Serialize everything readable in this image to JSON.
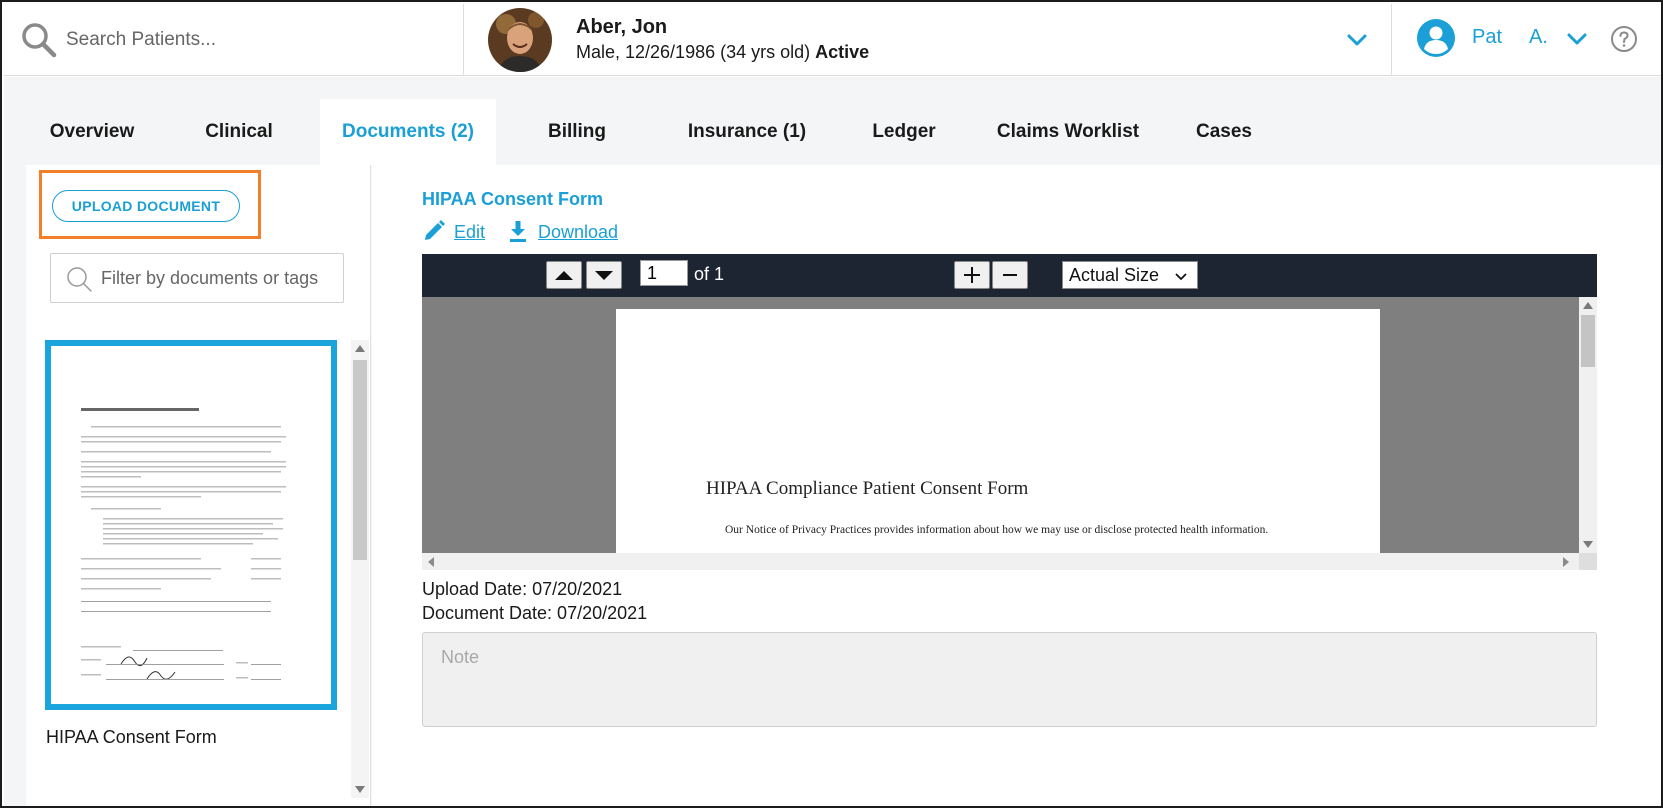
{
  "header": {
    "search_placeholder": "Search Patients...",
    "patient": {
      "name": "Aber, Jon",
      "demographics": "Male, 12/26/1986 (34 yrs old)",
      "status": "Active"
    },
    "user": {
      "first_name": "Pat",
      "last_initial": "A."
    }
  },
  "tabs": [
    {
      "label": "Overview",
      "active": false
    },
    {
      "label": "Clinical",
      "active": false
    },
    {
      "label": "Documents (2)",
      "active": true
    },
    {
      "label": "Billing",
      "active": false
    },
    {
      "label": "Insurance (1)",
      "active": false
    },
    {
      "label": "Ledger",
      "active": false
    },
    {
      "label": "Claims Worklist",
      "active": false
    },
    {
      "label": "Cases",
      "active": false
    }
  ],
  "documents_panel": {
    "upload_label": "UPLOAD DOCUMENT",
    "filter_placeholder": "Filter by documents or tags",
    "items": [
      {
        "label": "HIPAA Consent Form",
        "selected": true
      }
    ]
  },
  "document": {
    "title": "HIPAA Consent Form",
    "edit_label": "Edit",
    "download_label": "Download",
    "viewer": {
      "page": "1",
      "of_label": "of 1",
      "zoom": "Actual Size",
      "page_heading": "HIPAA Compliance Patient Consent Form",
      "page_text": "Our Notice of Privacy Practices provides information about how we may use or disclose protected health information."
    },
    "upload_date": "Upload Date: 07/20/2021",
    "document_date": "Document Date: 07/20/2021",
    "note_placeholder": "Note"
  },
  "colors": {
    "accent": "#1a9fd6",
    "highlight_orange": "#f37f2a",
    "thumbnail_border": "#1aa6dc",
    "viewer_toolbar": "#1d2533"
  },
  "icons": [
    "search-icon",
    "chevron-down-icon",
    "user-circle-icon",
    "help-icon",
    "pencil-icon",
    "download-icon",
    "arrow-up-icon",
    "arrow-down-icon",
    "plus-icon",
    "minus-icon"
  ]
}
